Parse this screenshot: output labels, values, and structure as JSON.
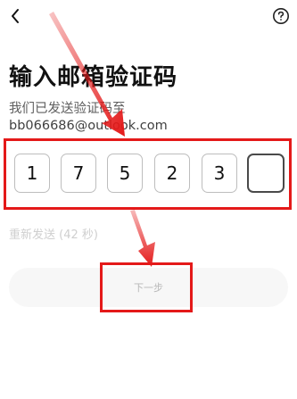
{
  "header": {
    "back_icon": "chevron-left-icon",
    "help_icon": "question-circle-icon"
  },
  "title": "输入邮箱验证码",
  "subtitle": {
    "prefix": "我们已发送验证码至 ",
    "email": "bb066686@outlook.com"
  },
  "code": {
    "digits": [
      "1",
      "7",
      "5",
      "2",
      "3",
      ""
    ]
  },
  "resend_text": "重新发送 (42 秒)",
  "next_button_label": "下一步",
  "colors": {
    "annotation": "#e41919",
    "box_border": "#bdbdbd",
    "active_box_border": "#4a4a4a",
    "disabled_text": "#b8b8b8"
  }
}
